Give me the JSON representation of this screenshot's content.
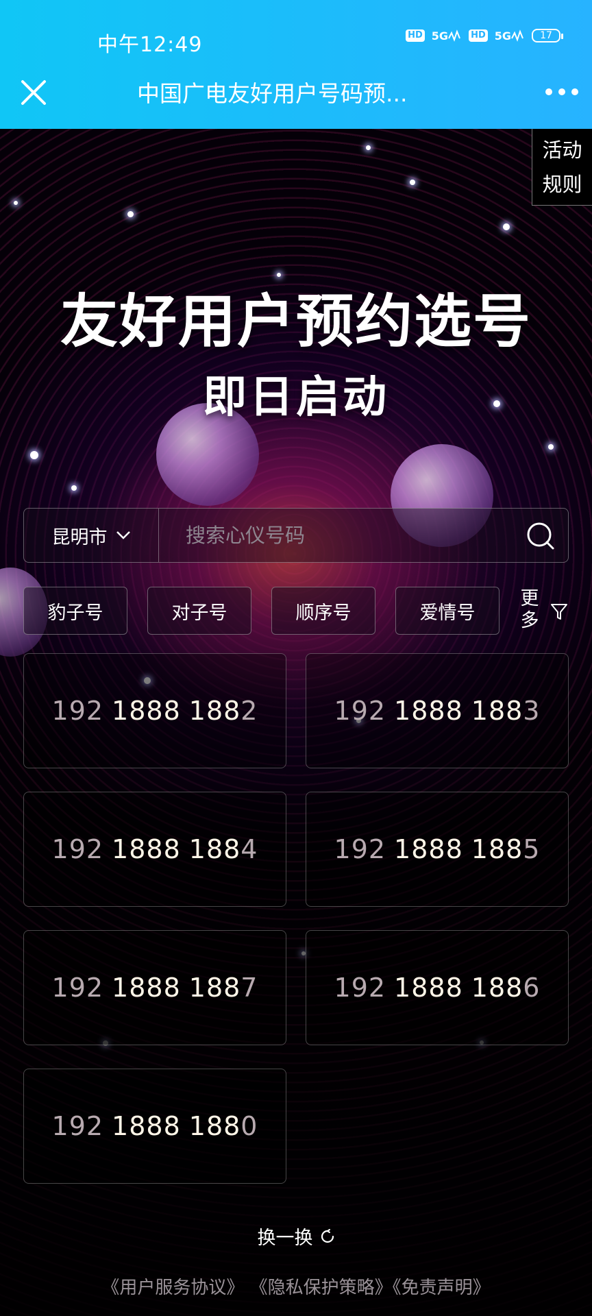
{
  "status_bar": {
    "time": "中午12:49",
    "hd1": "HD",
    "net1": "5G",
    "hd2": "HD",
    "net2": "5G",
    "battery": "17"
  },
  "nav": {
    "title": "中国广电友好用户号码预..."
  },
  "rules_tag": {
    "line1": "活动",
    "line2": "规则"
  },
  "hero": {
    "headline": "友好用户预约选号",
    "subheadline": "即日启动"
  },
  "search": {
    "city": "昆明市",
    "placeholder": "搜索心仪号码"
  },
  "filters": {
    "chips": [
      "豹子号",
      "对子号",
      "顺序号",
      "爱情号"
    ],
    "more_line1": "更",
    "more_line2": "多"
  },
  "numbers": [
    {
      "prefix": "192",
      "mid": "1888",
      "last3": "188",
      "end": "2"
    },
    {
      "prefix": "192",
      "mid": "1888",
      "last3": "188",
      "end": "3"
    },
    {
      "prefix": "192",
      "mid": "1888",
      "last3": "188",
      "end": "4"
    },
    {
      "prefix": "192",
      "mid": "1888",
      "last3": "188",
      "end": "5"
    },
    {
      "prefix": "192",
      "mid": "1888",
      "last3": "188",
      "end": "7"
    },
    {
      "prefix": "192",
      "mid": "1888",
      "last3": "188",
      "end": "6"
    },
    {
      "prefix": "192",
      "mid": "1888",
      "last3": "188",
      "end": "0"
    }
  ],
  "refresh_label": "换一换",
  "footer": {
    "agreement": "《用户服务协议》",
    "privacy": "《隐私保护策略》",
    "disclaimer": "《免责声明》"
  },
  "colors": {
    "header_start": "#10c6f6",
    "header_end": "#27b3ff",
    "number_highlight": "#fff6e8",
    "number_muted": "#b8aab0"
  }
}
